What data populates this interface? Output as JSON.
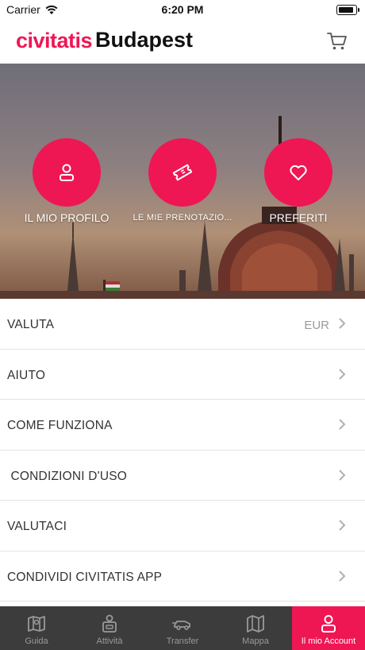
{
  "status_bar": {
    "carrier": "Carrier",
    "time": "6:20 PM",
    "battery_level": 0.9
  },
  "header": {
    "brand": "civitatis",
    "city": "Budapest"
  },
  "quick_actions": [
    {
      "label": "IL MIO PROFILO",
      "icon": "person-icon"
    },
    {
      "label": "LE MIE PRENOTAZIO...",
      "icon": "ticket-icon"
    },
    {
      "label": "PREFERITI",
      "icon": "heart-icon"
    }
  ],
  "menu": [
    {
      "label": "VALUTA",
      "value": "EUR"
    },
    {
      "label": "AIUTO"
    },
    {
      "label": "COME FUNZIONA"
    },
    {
      "label": " CONDIZIONI D'USO"
    },
    {
      "label": "VALUTACI"
    },
    {
      "label": "CONDIVIDI CIVITATIS APP"
    }
  ],
  "tabs": [
    {
      "label": "Guida",
      "icon": "guide-map-icon",
      "active": false
    },
    {
      "label": "Attività",
      "icon": "activities-icon",
      "active": false
    },
    {
      "label": "Transfer",
      "icon": "car-icon",
      "active": false
    },
    {
      "label": "Mappa",
      "icon": "map-icon",
      "active": false
    },
    {
      "label": "Il mio Account",
      "icon": "person-icon",
      "active": true
    }
  ],
  "colors": {
    "brand": "#ef1654",
    "tab_bar": "#3c3c3c",
    "tab_inactive": "#9a9a9a"
  }
}
